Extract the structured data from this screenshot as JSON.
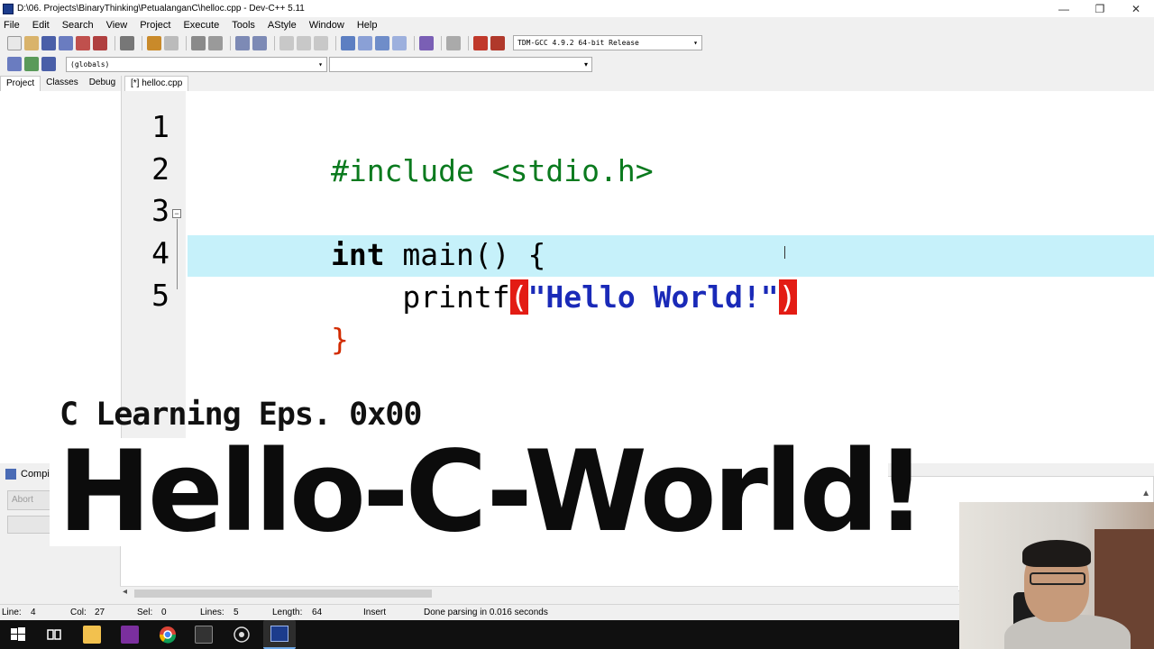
{
  "window": {
    "title": "D:\\06. Projects\\BinaryThinking\\PetualanganC\\helloc.cpp - Dev-C++ 5.11",
    "minimize": "—",
    "restore": "❐",
    "close": "✕"
  },
  "menu": [
    "File",
    "Edit",
    "Search",
    "View",
    "Project",
    "Execute",
    "Tools",
    "AStyle",
    "Window",
    "Help"
  ],
  "toolbar": {
    "compiler": "TDM-GCC 4.9.2 64-bit Release",
    "scope": "(globals)"
  },
  "left_tabs": [
    "Project",
    "Classes",
    "Debug"
  ],
  "editor": {
    "tab": "[*] helloc.cpp",
    "line_numbers": [
      "1",
      "2",
      "3",
      "4",
      "5"
    ],
    "line1_pre": "#include <stdio.h>",
    "line3_kw": "int",
    "line3_rest": " main() {",
    "line4_fn": "    printf",
    "line4_open": "(",
    "line4_str": "\"Hello World!\"",
    "line4_close": ")",
    "line5": "}"
  },
  "bottom": {
    "panel_title": "Compi",
    "abort_label": "Abort"
  },
  "status": {
    "line_label": "Line:",
    "line_value": "4",
    "col_label": "Col:",
    "col_value": "27",
    "sel_label": "Sel:",
    "sel_value": "0",
    "lines_label": "Lines:",
    "lines_value": "5",
    "length_label": "Length:",
    "length_value": "64",
    "mode": "Insert",
    "message": "Done parsing in 0.016 seconds"
  },
  "overlay": {
    "subtitle": "C Learning Eps. 0x00",
    "title": "Hello-C-World!"
  },
  "colors": {
    "current_line": "#c6f1fa",
    "brace_match": "#e31c14",
    "string": "#1a2ab8",
    "preprocessor": "#0a7a1e"
  }
}
